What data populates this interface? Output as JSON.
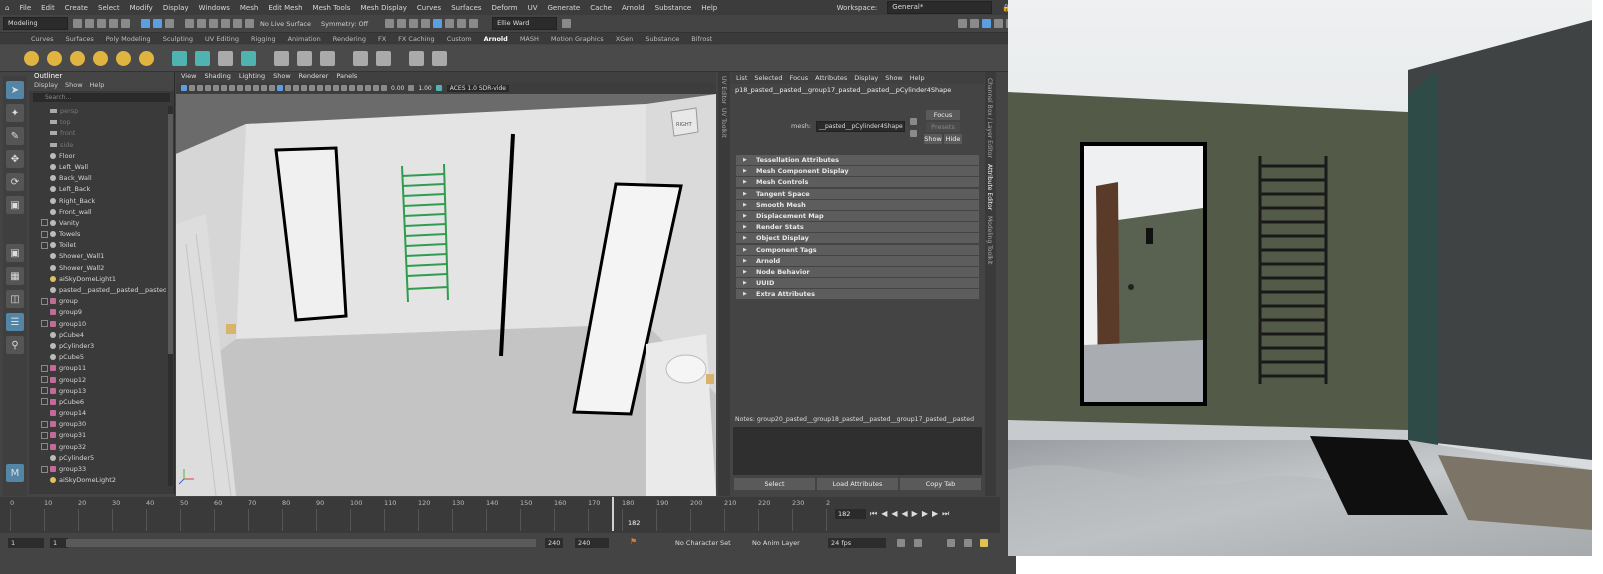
{
  "menu": [
    "File",
    "Edit",
    "Create",
    "Select",
    "Modify",
    "Display",
    "Windows",
    "Mesh",
    "Edit Mesh",
    "Mesh Tools",
    "Mesh Display",
    "Curves",
    "Surfaces",
    "Deform",
    "UV",
    "Generate",
    "Cache",
    "Arnold",
    "Substance",
    "Help"
  ],
  "workspace_label": "Workspace:",
  "workspace_value": "General*",
  "status": {
    "mode": "Modeling",
    "live_surface": "No Live Surface",
    "symmetry": "Symmetry: Off",
    "user": "Ellie Ward"
  },
  "shelf_tabs": [
    "Curves",
    "Surfaces",
    "Poly Modeling",
    "Sculpting",
    "UV Editing",
    "Rigging",
    "Animation",
    "Rendering",
    "FX",
    "FX Caching",
    "Custom",
    "Arnold",
    "MASH",
    "Motion Graphics",
    "XGen",
    "Substance",
    "Bifrost"
  ],
  "shelf_active": "Arnold",
  "outliner": {
    "title": "Outliner",
    "menu": [
      "Display",
      "Show",
      "Help"
    ],
    "search_placeholder": "Search...",
    "items": [
      {
        "label": "persp",
        "type": "cam",
        "dim": true,
        "exp": false
      },
      {
        "label": "top",
        "type": "cam",
        "dim": true,
        "exp": false
      },
      {
        "label": "front",
        "type": "cam",
        "dim": true,
        "exp": false
      },
      {
        "label": "side",
        "type": "cam",
        "dim": true,
        "exp": false
      },
      {
        "label": "Floor",
        "type": "mesh",
        "dim": false,
        "exp": false
      },
      {
        "label": "Left_Wall",
        "type": "mesh",
        "dim": false,
        "exp": false
      },
      {
        "label": "Back_Wall",
        "type": "mesh",
        "dim": false,
        "exp": false
      },
      {
        "label": "Left_Back",
        "type": "mesh",
        "dim": false,
        "exp": false
      },
      {
        "label": "Right_Back",
        "type": "mesh",
        "dim": false,
        "exp": false
      },
      {
        "label": "Front_wall",
        "type": "mesh",
        "dim": false,
        "exp": false
      },
      {
        "label": "Vanity",
        "type": "mesh",
        "dim": false,
        "exp": true
      },
      {
        "label": "Towels",
        "type": "mesh",
        "dim": false,
        "exp": true
      },
      {
        "label": "Toilet",
        "type": "mesh",
        "dim": false,
        "exp": true
      },
      {
        "label": "Shower_Wall1",
        "type": "mesh",
        "dim": false,
        "exp": false
      },
      {
        "label": "Shower_Wall2",
        "type": "mesh",
        "dim": false,
        "exp": false
      },
      {
        "label": "aiSkyDomeLight1",
        "type": "light",
        "dim": false,
        "exp": false
      },
      {
        "label": "pasted__pasted__pasted__pasted__p",
        "type": "mesh",
        "dim": false,
        "exp": false
      },
      {
        "label": "group",
        "type": "grp",
        "dim": false,
        "exp": true
      },
      {
        "label": "group9",
        "type": "grp",
        "dim": false,
        "exp": false
      },
      {
        "label": "group10",
        "type": "grp",
        "dim": false,
        "exp": true
      },
      {
        "label": "pCube4",
        "type": "mesh",
        "dim": false,
        "exp": false
      },
      {
        "label": "pCylinder3",
        "type": "mesh",
        "dim": false,
        "exp": false
      },
      {
        "label": "pCube5",
        "type": "mesh",
        "dim": false,
        "exp": false
      },
      {
        "label": "group11",
        "type": "grp",
        "dim": false,
        "exp": true
      },
      {
        "label": "group12",
        "type": "grp",
        "dim": false,
        "exp": true
      },
      {
        "label": "group13",
        "type": "grp",
        "dim": false,
        "exp": true
      },
      {
        "label": "pCube6",
        "type": "grp",
        "dim": false,
        "exp": true
      },
      {
        "label": "group14",
        "type": "grp",
        "dim": false,
        "exp": false
      },
      {
        "label": "group30",
        "type": "grp",
        "dim": false,
        "exp": true
      },
      {
        "label": "group31",
        "type": "grp",
        "dim": false,
        "exp": true
      },
      {
        "label": "group32",
        "type": "grp",
        "dim": false,
        "exp": true
      },
      {
        "label": "pCylinder5",
        "type": "mesh",
        "dim": false,
        "exp": false
      },
      {
        "label": "group33",
        "type": "grp",
        "dim": false,
        "exp": true
      },
      {
        "label": "aiSkyDomeLight2",
        "type": "light",
        "dim": false,
        "exp": false
      }
    ]
  },
  "viewport": {
    "menu": [
      "View",
      "Shading",
      "Lighting",
      "Show",
      "Renderer",
      "Panels"
    ],
    "exposure": "0.00",
    "gamma": "1.00",
    "color_space": "ACES 1.0 SDR-vide",
    "viewcube_label": "RIGHT"
  },
  "side_tabs_left": [
    "UV Editor",
    "UV Toolkit"
  ],
  "attribute_editor": {
    "menu": [
      "List",
      "Selected",
      "Focus",
      "Attributes",
      "Display",
      "Show",
      "Help"
    ],
    "node_name": "p18_pasted__pasted__group17_pasted__pasted__pCylinder4Shape",
    "mesh_label": "mesh:",
    "mesh_value": "__pasted__pCylinder4Shape",
    "focus_btn": "Focus",
    "presets_btn": "Presets",
    "show_btn": "Show",
    "hide_btn": "Hide",
    "sections": [
      "Tessellation Attributes",
      "Mesh Component Display",
      "Mesh Controls",
      "Tangent Space",
      "Smooth Mesh",
      "Displacement Map",
      "Render Stats",
      "Object Display",
      "Component Tags",
      "Arnold",
      "Node Behavior",
      "UUID",
      "Extra Attributes"
    ],
    "notes": "Notes:  group20_pasted__group18_pasted__pasted__group17_pasted__pasted",
    "bottom_buttons": [
      "Select",
      "Load Attributes",
      "Copy Tab"
    ]
  },
  "side_tabs_right": [
    "Channel Box / Layer Editor",
    "Attribute Editor",
    "Modeling Toolkit"
  ],
  "timeline": {
    "ticks": [
      "0",
      "10",
      "20",
      "30",
      "40",
      "50",
      "60",
      "70",
      "80",
      "90",
      "100",
      "110",
      "120",
      "130",
      "140",
      "150",
      "160",
      "170",
      "180",
      "190",
      "200",
      "210",
      "220",
      "230",
      "2"
    ],
    "current": "182",
    "current_field": "182"
  },
  "range": {
    "start": "1",
    "start2": "1",
    "end": "240",
    "end2": "240",
    "character_set": "No Character Set",
    "anim_layer": "No Anim Layer",
    "fps": "24 fps"
  }
}
